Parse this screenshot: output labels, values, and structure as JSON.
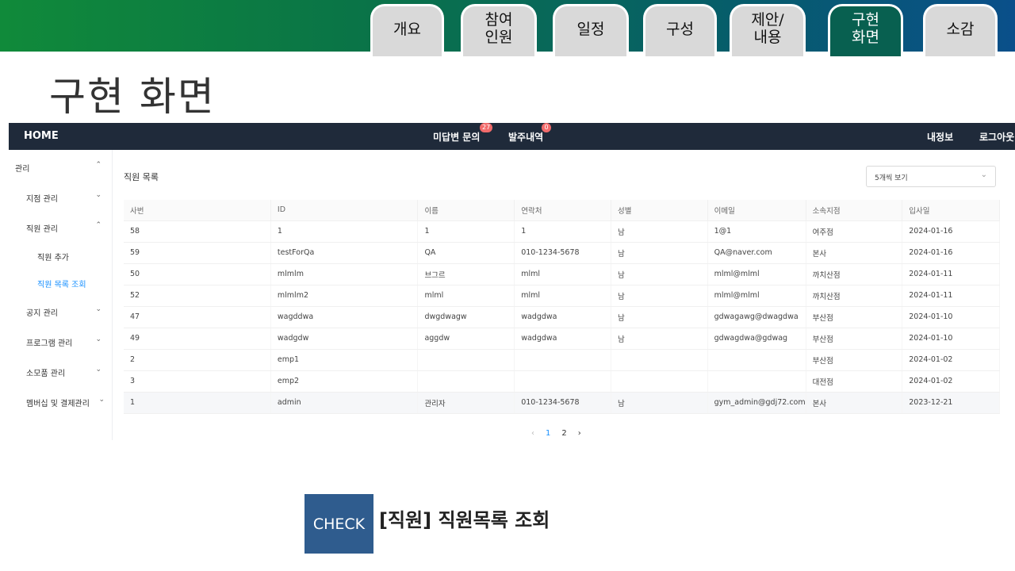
{
  "slide_tabs": [
    {
      "label": "개요"
    },
    {
      "label": "참여\n인원"
    },
    {
      "label": "일정"
    },
    {
      "label": "구성"
    },
    {
      "label": "제안/\n내용"
    },
    {
      "label": "구현\n화면"
    },
    {
      "label": "소감"
    }
  ],
  "slide_title": "구현 화면",
  "app": {
    "nav": {
      "home": "HOME",
      "unanswered": "미답변 문의",
      "unanswered_badge": "27",
      "orders": "발주내역",
      "orders_badge": "0",
      "my_info": "내정보",
      "logout": "로그아웃"
    },
    "sidebar": {
      "items": [
        {
          "label": "관리"
        },
        {
          "label": "지점 관리"
        },
        {
          "label": "직원 관리"
        },
        {
          "label": "직원 추가"
        },
        {
          "label": "직원 목록 조회"
        },
        {
          "label": "공지 관리"
        },
        {
          "label": "프로그램 관리"
        },
        {
          "label": "소모품 관리"
        },
        {
          "label": "멤버십 및 결제관리"
        }
      ]
    },
    "content": {
      "title": "직원 목록",
      "page_size_select": "5개씩 보기",
      "columns": [
        "사번",
        "ID",
        "이름",
        "연락처",
        "성별",
        "이메일",
        "소속지점",
        "입사일"
      ],
      "rows": [
        [
          "58",
          "1",
          "1",
          "1",
          "남",
          "1@1",
          "여주점",
          "2024-01-16"
        ],
        [
          "59",
          "testForQa",
          "QA",
          "010-1234-5678",
          "남",
          "QA@naver.com",
          "본사",
          "2024-01-16"
        ],
        [
          "50",
          "mlmlm",
          "브그르",
          "mlml",
          "남",
          "mlml@mlml",
          "까치산점",
          "2024-01-11"
        ],
        [
          "52",
          "mlmlm2",
          "mlml",
          "mlml",
          "남",
          "mlml@mlml",
          "까치산점",
          "2024-01-11"
        ],
        [
          "47",
          "wagddwa",
          "dwgdwagw",
          "wadgdwa",
          "남",
          "gdwagawg@dwagdwa",
          "부산점",
          "2024-01-10"
        ],
        [
          "49",
          "wadgdw",
          "aggdw",
          "wadgdwa",
          "남",
          "gdwagdwa@gdwag",
          "부산점",
          "2024-01-10"
        ],
        [
          "2",
          "emp1",
          "",
          "",
          "",
          "",
          "부산점",
          "2024-01-02"
        ],
        [
          "3",
          "emp2",
          "",
          "",
          "",
          "",
          "대전점",
          "2024-01-02"
        ],
        [
          "1",
          "admin",
          "관리자",
          "010-1234-5678",
          "남",
          "gym_admin@gdj72.com",
          "본사",
          "2023-12-21"
        ]
      ],
      "pagination": {
        "prev": "‹",
        "pages": [
          "1",
          "2"
        ],
        "current": "1",
        "next": "›"
      }
    }
  },
  "check_label": "CHECK",
  "caption": "[직원] 직원목록 조회"
}
